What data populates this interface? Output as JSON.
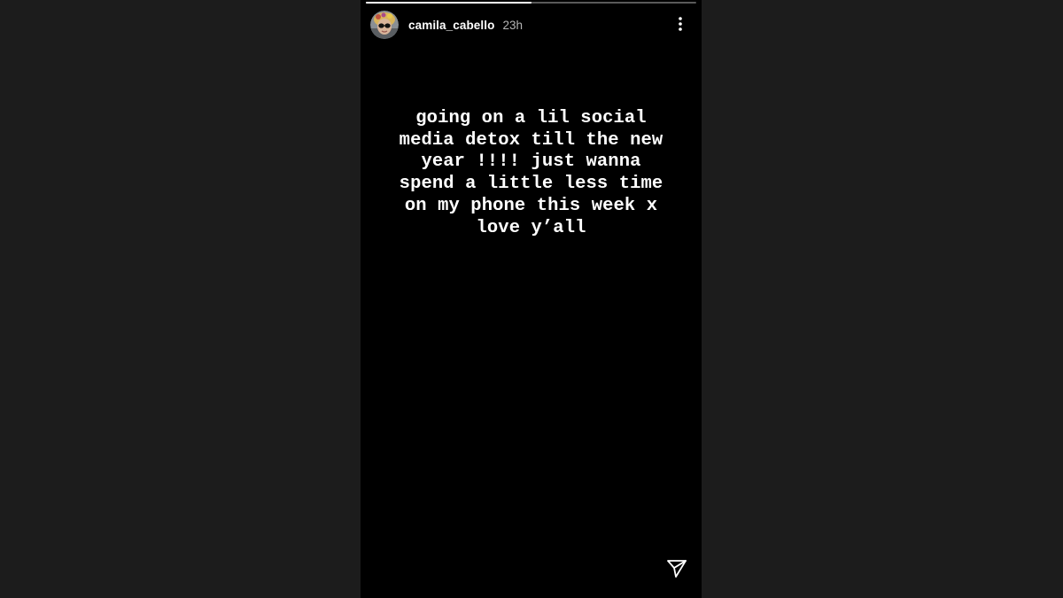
{
  "story": {
    "progress": 0.5,
    "user": {
      "username": "camila_cabello",
      "time_ago": "23h",
      "avatar_icon": "profile-avatar"
    },
    "message": "going on a lil social\nmedia detox till the new\nyear !!!! just wanna\nspend a little less time\non my phone this week x\nlove y’all",
    "actions": {
      "more_icon": "more-vertical-icon",
      "share_icon": "send-icon"
    }
  },
  "colors": {
    "background": "#1c1c1c",
    "story_background": "#000000",
    "text": "#ffffff",
    "timestamp": "#b5b5b5"
  }
}
